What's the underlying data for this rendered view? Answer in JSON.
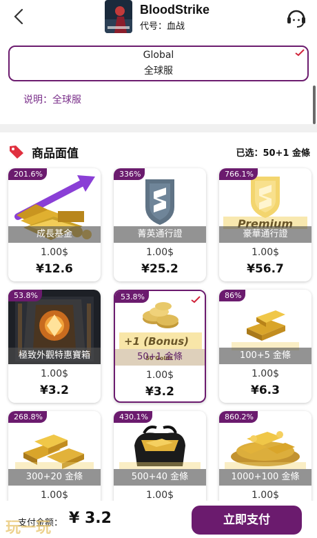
{
  "header": {
    "game_title": "BloodStrike",
    "game_code": "代号：血战",
    "back_icon": "chevron-left-icon",
    "support_icon": "headset-icon"
  },
  "server": {
    "line1": "Global",
    "line2": "全球服"
  },
  "note": "说明：全球服",
  "section": {
    "title": "商品面值",
    "selected": "已选：50+1 金條"
  },
  "products": [
    {
      "badge": "201.6%",
      "label": "成長基金",
      "amount": "1.00$",
      "price": "¥12.6",
      "art": "gold-arrow"
    },
    {
      "badge": "336%",
      "label": "菁英通行證",
      "amount": "1.00$",
      "price": "¥25.2",
      "art": "shield-gray"
    },
    {
      "badge": "766.1%",
      "label": "豪華通行證",
      "amount": "1.00$",
      "price": "¥56.7",
      "art": "shield-gold",
      "art_text": "Premium"
    },
    {
      "badge": "53.8%",
      "label": "極致外觀特惠寶箱",
      "amount": "1.00$",
      "price": "¥3.2",
      "art": "chest"
    },
    {
      "badge": "53.8%",
      "label": "50+1 金條",
      "amount": "1.00$",
      "price": "¥3.2",
      "art": "coins",
      "art_text": "+1 (Bonus)",
      "art_text2": "50 Golds",
      "selected": true
    },
    {
      "badge": "86%",
      "label": "100+5 金條",
      "amount": "1.00$",
      "price": "¥6.3",
      "art": "bars-small"
    },
    {
      "badge": "268.8%",
      "label": "300+20 金條",
      "amount": "1.00$",
      "price": "",
      "art": "bars-medium"
    },
    {
      "badge": "430.1%",
      "label": "500+40 金條",
      "amount": "1.00$",
      "price": "",
      "art": "bag"
    },
    {
      "badge": "860.2%",
      "label": "1000+100 金條",
      "amount": "1.00$",
      "price": "",
      "art": "pile"
    }
  ],
  "footer": {
    "pay_label": "支付金额：",
    "pay_total": "¥ 3.2",
    "pay_button": "立即支付",
    "watermark": "玩一玩"
  },
  "colors": {
    "accent": "#6b1b6e",
    "check": "#d0243a",
    "gold": "#d8a928"
  }
}
